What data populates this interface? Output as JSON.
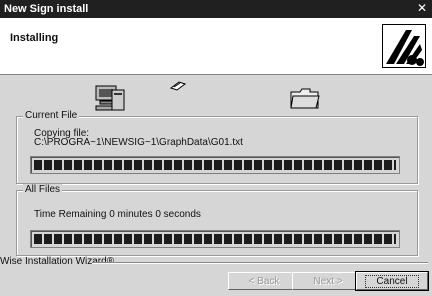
{
  "window": {
    "title": "New Sign install"
  },
  "header": {
    "title": "Installing"
  },
  "current_file": {
    "legend": "Current File",
    "action": "Copying file:",
    "path": "C:\\PROGRA~1\\NEWSIG~1\\GraphData\\G01.txt",
    "progress": 1.0
  },
  "all_files": {
    "legend": "All Files",
    "time_remaining": "Time Remaining 0 minutes 0 seconds",
    "progress": 1.0
  },
  "footer": {
    "brand": "Wise Installation Wizard®",
    "back_label": "< Back",
    "next_label": "Next >",
    "cancel_label": "Cancel"
  },
  "icons": [
    "computer-icon",
    "flying-paper-icon",
    "folder-icon",
    "logo-icon",
    "close-icon"
  ]
}
